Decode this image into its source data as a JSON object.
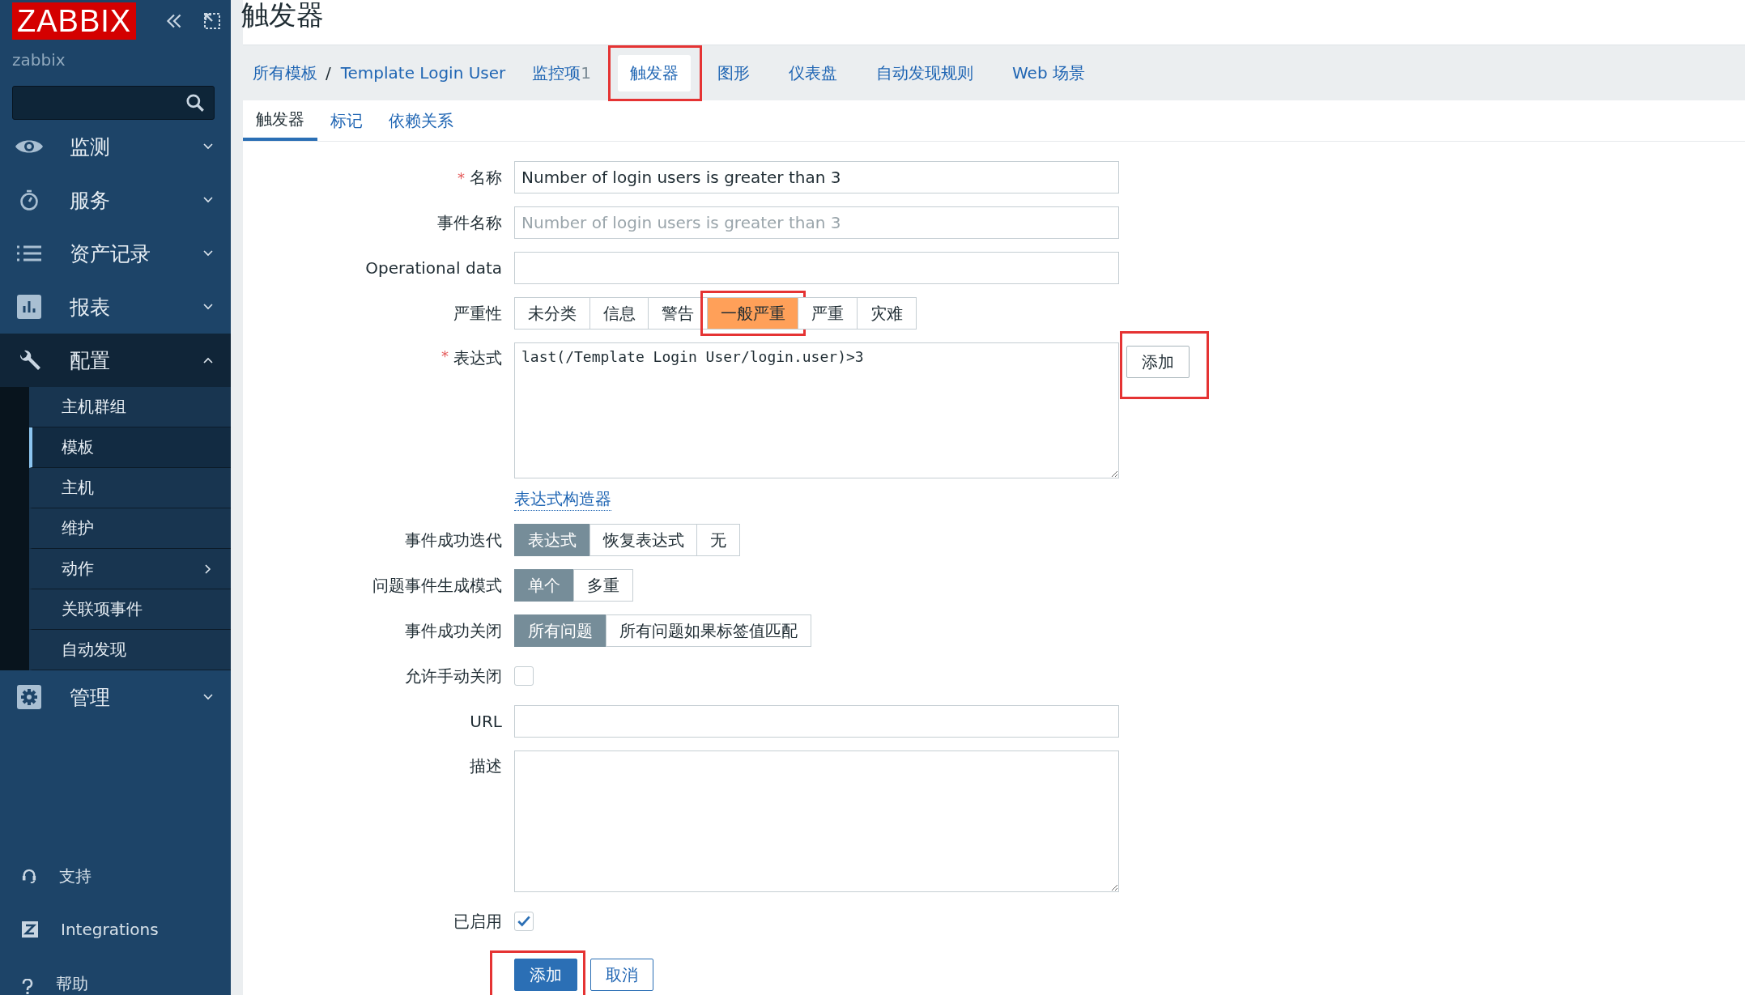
{
  "app": {
    "logo": "ZABBIX",
    "user": "zabbix"
  },
  "sidebar": {
    "menu": [
      {
        "label": "监测",
        "expanded": false
      },
      {
        "label": "服务",
        "expanded": false
      },
      {
        "label": "资产记录",
        "expanded": false
      },
      {
        "label": "报表",
        "expanded": false
      },
      {
        "label": "配置",
        "expanded": true,
        "children": [
          {
            "label": "主机群组",
            "selected": false,
            "has_submenu": false
          },
          {
            "label": "模板",
            "selected": true,
            "has_submenu": false
          },
          {
            "label": "主机",
            "selected": false,
            "has_submenu": false
          },
          {
            "label": "维护",
            "selected": false,
            "has_submenu": false
          },
          {
            "label": "动作",
            "selected": false,
            "has_submenu": true
          },
          {
            "label": "关联项事件",
            "selected": false,
            "has_submenu": false
          },
          {
            "label": "自动发现",
            "selected": false,
            "has_submenu": false
          }
        ]
      },
      {
        "label": "管理",
        "expanded": false
      }
    ],
    "bottom": [
      {
        "label": "支持"
      },
      {
        "label": "Integrations"
      },
      {
        "label": "帮助"
      }
    ]
  },
  "page_title": "触发器",
  "breadcrumb": [
    {
      "label": "所有模板"
    },
    {
      "label": "Template Login User"
    }
  ],
  "breadcrumb_separator": "/",
  "nav_tabs": [
    {
      "label": "监控项",
      "count": "1",
      "selected": false
    },
    {
      "label": "触发器",
      "selected": true,
      "highlighted": true
    },
    {
      "label": "图形",
      "selected": false
    },
    {
      "label": "仪表盘",
      "selected": false
    },
    {
      "label": "自动发现规则",
      "selected": false
    },
    {
      "label": "Web 场景",
      "selected": false
    }
  ],
  "sub_tabs": [
    {
      "label": "触发器",
      "selected": true
    },
    {
      "label": "标记",
      "selected": false
    },
    {
      "label": "依赖关系",
      "selected": false
    }
  ],
  "form": [
    {
      "kind": "text",
      "label": "名称",
      "required_mark": "*",
      "value": "Number of login users is greater than 3"
    },
    {
      "kind": "text",
      "label": "事件名称",
      "placeholder": "Number of login users is greater than 3"
    },
    {
      "kind": "text",
      "label": "Operational data"
    },
    {
      "kind": "severity",
      "label": "严重性",
      "options": [
        {
          "label": "未分类",
          "selected": false
        },
        {
          "label": "信息",
          "selected": false
        },
        {
          "label": "警告",
          "selected": false
        },
        {
          "label": "一般严重",
          "selected": true,
          "highlighted": true,
          "color": "#ffa059"
        },
        {
          "label": "严重",
          "selected": false
        },
        {
          "label": "灾难",
          "selected": false
        }
      ]
    },
    {
      "kind": "expression",
      "label": "表达式",
      "required_mark": "*",
      "value": "last(/Template Login User/login.user)>3",
      "button": {
        "label": "添加",
        "highlighted": true
      },
      "link": "表达式构造器"
    },
    {
      "kind": "segmented",
      "label": "事件成功迭代",
      "options": [
        {
          "label": "表达式",
          "selected": true
        },
        {
          "label": "恢复表达式",
          "selected": false
        },
        {
          "label": "无",
          "selected": false
        }
      ]
    },
    {
      "kind": "segmented",
      "label": "问题事件生成模式",
      "options": [
        {
          "label": "单个",
          "selected": true
        },
        {
          "label": "多重",
          "selected": false
        }
      ]
    },
    {
      "kind": "segmented",
      "label": "事件成功关闭",
      "options": [
        {
          "label": "所有问题",
          "selected": true
        },
        {
          "label": "所有问题如果标签值匹配",
          "selected": false
        }
      ]
    },
    {
      "kind": "checkbox",
      "label": "允许手动关闭",
      "checked": false
    },
    {
      "kind": "text",
      "label": "URL"
    },
    {
      "kind": "textarea",
      "label": "描述"
    },
    {
      "kind": "checkbox",
      "label": "已启用",
      "checked": true
    }
  ],
  "actions": [
    {
      "label": "添加",
      "kind": "primary",
      "highlighted": true
    },
    {
      "label": "取消",
      "kind": "secondary"
    }
  ]
}
